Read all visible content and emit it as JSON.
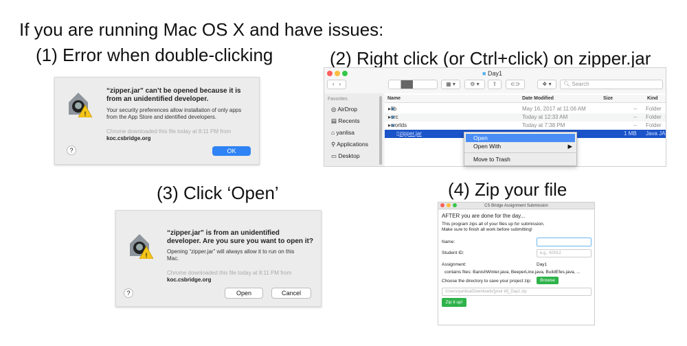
{
  "headings": {
    "main": "If you are running Mac OS X and have issues:",
    "step1": "(1) Error when double-clicking",
    "step2": "(2) Right click (or Ctrl+click) on zipper.jar",
    "step3": "(3) Click ‘Open’",
    "step4": "(4) Zip your file"
  },
  "dialog1": {
    "title": "“zipper.jar” can’t be opened because it is from an unidentified developer.",
    "message": "Your security preferences allow installation of only apps from the App Store and identified developers.",
    "source": "Chrome downloaded this file today at 8:11 PM from",
    "host": "koc.csbridge.org",
    "help": "?",
    "ok": "OK"
  },
  "finder": {
    "window_title": "Day1",
    "search_placeholder": "Search",
    "sidebar_header": "Favorites",
    "sidebar": [
      "AirDrop",
      "Recents",
      "yanlisa",
      "Applications",
      "Desktop"
    ],
    "columns": [
      "Name",
      "Date Modified",
      "Size",
      "Kind"
    ],
    "rows": [
      {
        "name": "lib",
        "date": "May 16, 2017 at 11:06 AM",
        "size": "--",
        "kind": "Folder"
      },
      {
        "name": "src",
        "date": "Today at 12:33 AM",
        "size": "--",
        "kind": "Folder"
      },
      {
        "name": "worlds",
        "date": "Today at 7:38 PM",
        "size": "--",
        "kind": "Folder"
      },
      {
        "name": "zipper.jar",
        "date": "",
        "size": "1 MB",
        "kind": "Java JAR"
      }
    ],
    "context_menu": [
      "Open",
      "Open With",
      "Move to Trash"
    ],
    "accent": "#2f6fdd"
  },
  "dialog2": {
    "title": "“zipper.jar” is from an unidentified developer. Are you sure you want to open it?",
    "message": "Opening “zipper.jar” will always allow it to run on this Mac.",
    "source": "Chrome downloaded this file today at 8:11 PM from",
    "host": "koc.csbridge.org",
    "help": "?",
    "open": "Open",
    "cancel": "Cancel"
  },
  "zipper": {
    "window_title": "CS Bridge Assignment Submission",
    "heading": "AFTER you are done for the day...",
    "intro1": "This program zips all of your files up for submission.",
    "intro2": "Make sure to finish all work before submitting!",
    "name_label": "Name:",
    "name_value": "",
    "id_label": "Student ID:",
    "id_placeholder": "e.g., K0012",
    "assignment_label": "Assignment:",
    "assignment_value": "Day1",
    "contains": "contains files: BanishWinter.java, BeeperLine.java, BuildEfes.java, ...",
    "dir_label": "Choose the directory to save your project zip:",
    "browse": "Browse",
    "path_placeholder": "/Users/yanlisa/Downloads/[your id]_Day1.zip",
    "zip_button": "Zip it up!",
    "accent": "#2eb34a"
  }
}
